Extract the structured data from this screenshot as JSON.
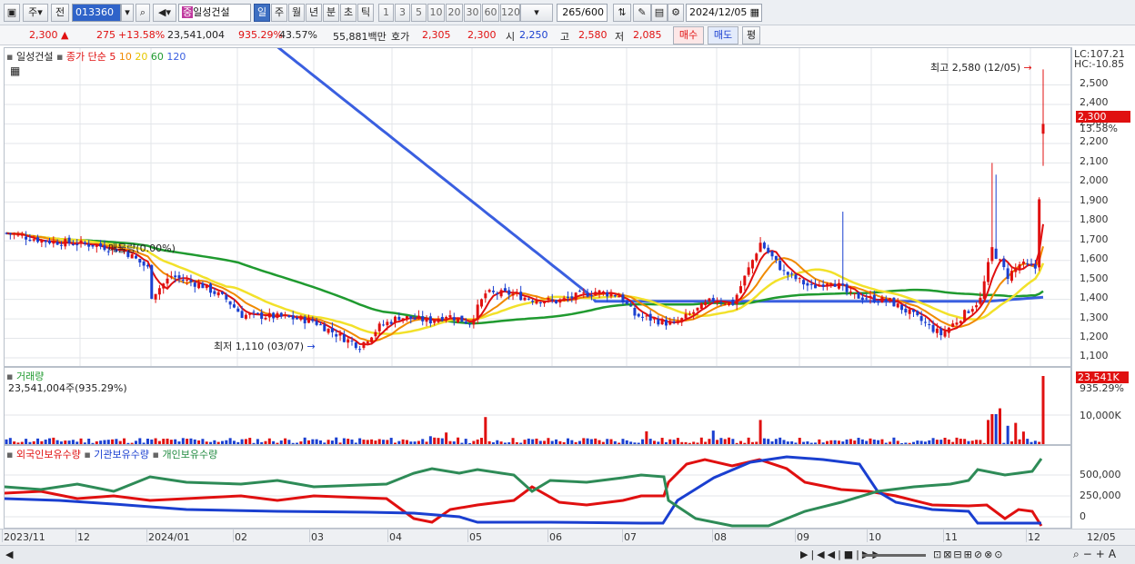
{
  "toolbar": {
    "period_type": "주",
    "prev_label": "전",
    "code": "013360",
    "stock_name": "일성건설",
    "periods": [
      "일",
      "주",
      "월",
      "년",
      "분",
      "초",
      "틱"
    ],
    "active_period": "일",
    "intervals": [
      "1",
      "3",
      "5",
      "10",
      "20",
      "30",
      "60",
      "120"
    ],
    "count": "265",
    "count_max": "/600",
    "date": "2024/12/05"
  },
  "quote": {
    "price": "2,300",
    "change": "275",
    "change_pct": "+13.58%",
    "volume": "23,541,004",
    "vol_ratio": "935.29%",
    "turnover": "43.57%",
    "amount": "55,881백만",
    "ask_label": "호가",
    "ask": "2,305",
    "bid": "2,300",
    "open_label": "시",
    "open": "2,250",
    "high_label": "고",
    "high": "2,580",
    "low_label": "저",
    "low": "2,085",
    "buy_label": "매수",
    "sell_label": "매도",
    "eval_label": "평"
  },
  "price_panel": {
    "name": "일성건설",
    "ma_label": "종가 단순",
    "ma_periods": [
      "5",
      "10",
      "20",
      "60",
      "120"
    ],
    "lc": "LC:107.21",
    "hc": "HC:-10.85",
    "high_annot": "최고 2,580 (12/05)",
    "low_annot": "최저 1,110 (03/07)",
    "overlay_label": "매물량(0.00%)",
    "last_price": "2,300",
    "last_pct": "13.58%",
    "y_ticks": [
      "2,500",
      "2,400",
      "2,300",
      "2,200",
      "2,100",
      "2,000",
      "1,900",
      "1,800",
      "1,700",
      "1,600",
      "1,500",
      "1,400",
      "1,300",
      "1,200",
      "1,100"
    ]
  },
  "volume_panel": {
    "title": "거래량",
    "value": "23,541,004주(935.29%)",
    "last": "23,541K",
    "last_pct": "935.29%",
    "tick": "10,000K"
  },
  "holdings_panel": {
    "series": [
      "외국인보유수량",
      "기관보유수량",
      "개인보유수량"
    ],
    "y_ticks": [
      "500,000",
      "250,000",
      "0"
    ]
  },
  "x_axis": [
    "2023/11",
    "12",
    "2024/01",
    "02",
    "03",
    "04",
    "05",
    "06",
    "07",
    "08",
    "09",
    "10",
    "11",
    "12",
    "12/05"
  ],
  "colors": {
    "up": "#e01010",
    "down": "#1a3fd0",
    "ma5": "#e01010",
    "ma10": "#f08a00",
    "ma20": "#f2e12a",
    "ma60": "#1f9a2f",
    "ma120": "#3a5fe0"
  }
}
